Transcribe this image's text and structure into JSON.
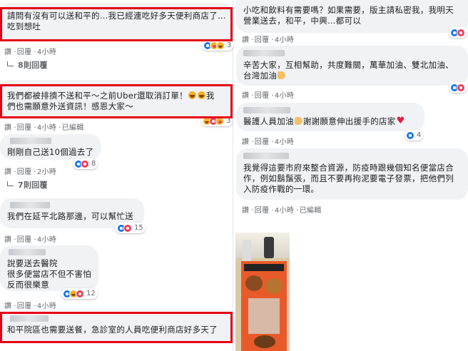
{
  "common": {
    "like": "讚",
    "reply": "回覆",
    "time": "4小時",
    "edited": "已編輯"
  },
  "left": {
    "c1": {
      "lines": [
        "請問有沒有可以送和平的…我已經連吃好多天便利商店了…",
        "吃到想吐"
      ],
      "reactions": "3"
    },
    "c1_replies": "8則回覆",
    "c2": {
      "lines": [
        "我們都被排擠不送和平～之前Uber還取消訂單！",
        "們也需願意外送資訊！感恩大家～"
      ],
      "line1_lead": "我",
      "reactions": "3"
    },
    "c3": {
      "lines": [
        "剛剛自己送10個過去了"
      ],
      "reactions": "8",
      "time": "2小時"
    },
    "c3_replies": "7則回覆",
    "c4": {
      "lines": [
        "我們在延平北路那邊，可以幫忙送"
      ],
      "reactions": "15"
    },
    "c5": {
      "lines": [
        "說要送去醫院",
        "很多便當店不但不害怕",
        "反而很樂意"
      ],
      "reactions": "12"
    },
    "c6": {
      "lines": [
        "和平院區也需要送餐，急診室的人員吃便利商店好多天了"
      ]
    }
  },
  "right": {
    "r1": {
      "lines": [
        "小吃和飲料有需要嗎？如果需要，版主請私密我，我明天",
        "營業送去，和平，中興…都可以"
      ]
    },
    "r2": {
      "lines": [
        "辛苦大家，互相幫助，共度難關，萬華加油、雙北加油、",
        "台灣加油"
      ]
    },
    "r3": {
      "lines": [
        "醫護人員加油",
        "謝謝願意伸出援手的店家"
      ],
      "reactions": "4"
    },
    "r4": {
      "lines": [
        "我覺得這要市府來整合資源，防疫時跟幾個知名便當店合",
        "作，例如鬍鬚張，而且不要再拘泥要電子發票，把他們列",
        "入防疫作戰的一環。"
      ]
    }
  }
}
